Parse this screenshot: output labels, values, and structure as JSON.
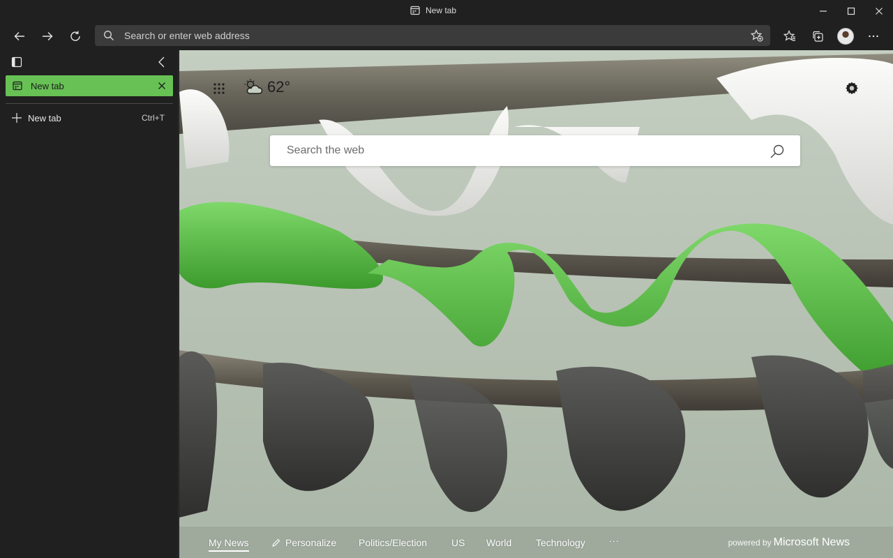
{
  "window": {
    "title": "New tab",
    "controls": [
      "minimize-icon",
      "maximize-icon",
      "close-icon"
    ]
  },
  "toolbar": {
    "address_placeholder": "Search or enter web address",
    "icons": [
      "back-arrow-icon",
      "forward-arrow-icon",
      "refresh-icon",
      "add-favorite-icon",
      "favorites-icon",
      "collections-icon",
      "profile-avatar",
      "more-menu-icon"
    ]
  },
  "sidebar": {
    "active_tab": {
      "label": "New tab"
    },
    "new_tab": {
      "label": "New tab",
      "shortcut": "Ctrl+T"
    }
  },
  "newtab_page": {
    "weather": {
      "temperature": "62°",
      "icon": "partly-cloudy-icon"
    },
    "search_placeholder": "Search the web",
    "news_tabs": [
      "My News",
      "Personalize",
      "Politics/Election",
      "US",
      "World",
      "Technology",
      "···"
    ],
    "active_news_tab": "My News",
    "powered_by": {
      "prefix": "powered by",
      "brand": "Microsoft News"
    }
  },
  "colors": {
    "chrome_bg": "#202020",
    "address_bg": "#3b3b3b",
    "active_tab": "#67c155",
    "page_bg": "#b7c3b4",
    "fabric_green": "#5ec24a",
    "fabric_dark": "#4a4a4a",
    "fabric_white": "#f2f2f0"
  }
}
